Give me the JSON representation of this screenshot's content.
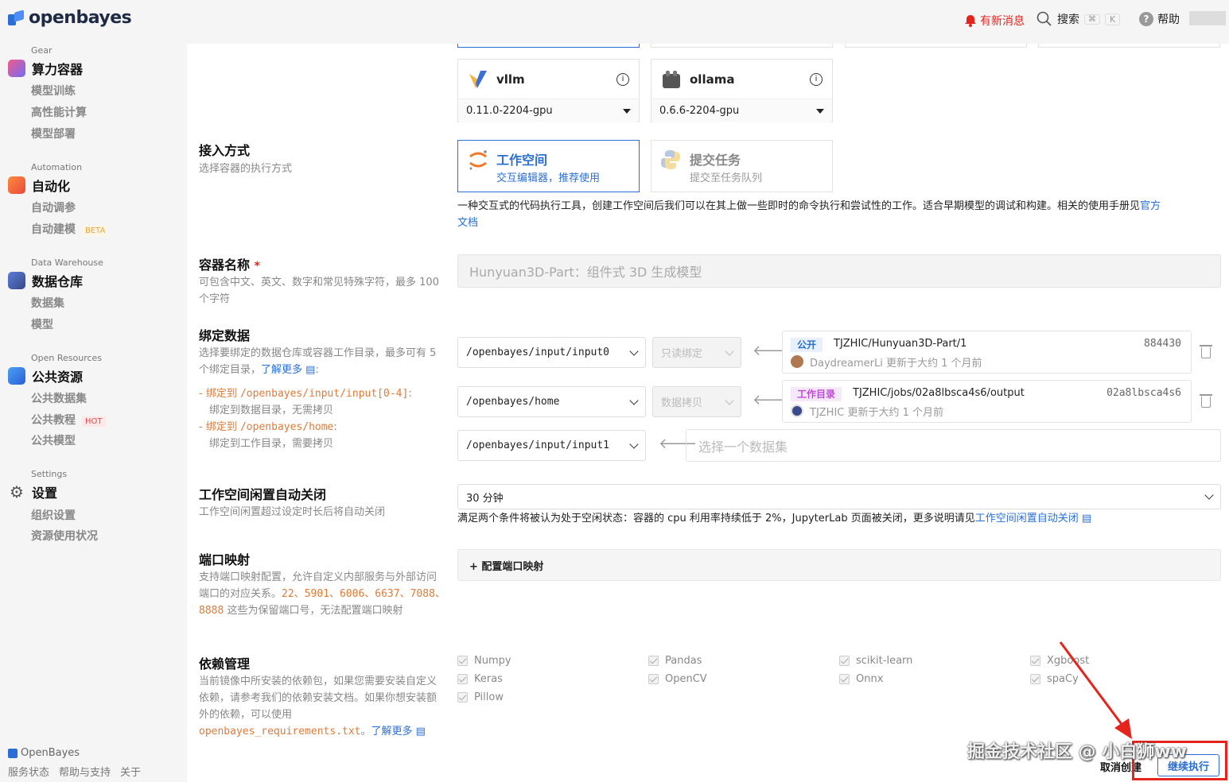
{
  "topbar": {
    "brand": "openbayes",
    "notifications": "有新消息",
    "search": "搜索",
    "search_key1": "⌘",
    "search_key2": "K",
    "help": "帮助"
  },
  "sidebar": {
    "sections": [
      {
        "category": "Gear",
        "title": "算力容器",
        "items": [
          "模型训练",
          "高性能计算",
          "模型部署"
        ]
      },
      {
        "category": "Automation",
        "title": "自动化",
        "items": [
          "自动调参",
          "自动建模"
        ],
        "badge": "BETA"
      },
      {
        "category": "Data Warehouse",
        "title": "数据仓库",
        "items": [
          "数据集",
          "模型"
        ]
      },
      {
        "category": "Open Resources",
        "title": "公共资源",
        "items": [
          "公共数据集",
          "公共教程",
          "公共模型"
        ],
        "badge": "HOT"
      },
      {
        "category": "Settings",
        "title": "设置",
        "items": [
          "组织设置",
          "资源使用状况"
        ]
      }
    ],
    "footer": {
      "brand": "OpenBayes",
      "links": [
        "服务状态",
        "帮助与支持",
        "关于"
      ]
    }
  },
  "images": [
    {
      "name": "vllm",
      "version": "0.11.0-2204-gpu"
    },
    {
      "name": "ollama",
      "version": "0.6.6-2204-gpu"
    }
  ],
  "access": {
    "title": "接入方式",
    "desc": "选择容器的执行方式",
    "workspace": {
      "title": "工作空间",
      "sub": "交互编辑器，推荐使用"
    },
    "task": {
      "title": "提交任务",
      "sub": "提交至任务队列"
    },
    "note": "一种交互式的代码执行工具，创建工作空间后我们可以在其上做一些即时的命令执行和尝试性的工作。适合早期模型的调试和构建。相关的使用手册见",
    "note_link1": "官方",
    "note_link2": "文档"
  },
  "container_name": {
    "title": "容器名称",
    "required": "*",
    "desc": "可包含中文、英文、数字和常见特殊字符，最多 100 个字符",
    "value": "Hunyuan3D-Part：组件式 3D 生成模型"
  },
  "bind": {
    "title": "绑定数据",
    "desc": "选择要绑定的数据仓库或容器工作目录，最多可有 5 个绑定目录，",
    "learn_more": "了解更多",
    "hint1_label": "绑定到",
    "hint1_path": "/openbayes/input/input[0-4]",
    "hint1_desc": "绑定到数据目录，无需拷贝",
    "hint2_label": "绑定到",
    "hint2_path": "/openbayes/home",
    "hint2_desc": "绑定到工作目录，需要拷贝",
    "rows": [
      {
        "path": "/openbayes/input/input0",
        "mode": "只读绑定",
        "tag": "公开",
        "source": "TJZHIC/Hunyuan3D-Part/1",
        "id": "884430",
        "meta": "DaydreamerLi 更新于大约 1 个月前"
      },
      {
        "path": "/openbayes/home",
        "mode": "数据拷贝",
        "tag": "工作目录",
        "source": "TJZHIC/jobs/02a8lbsca4s6/output",
        "id": "02a8lbsca4s6",
        "meta": "TJZHIC 更新于大约 1 个月前"
      },
      {
        "path": "/openbayes/input/input1",
        "placeholder": "选择一个数据集"
      }
    ]
  },
  "idle": {
    "title": "工作空间闲置自动关闭",
    "desc": "工作空间闲置超过设定时长后将自动关闭",
    "value": "30 分钟",
    "note": "满足两个条件将被认为处于空闲状态：容器的 cpu 利用率持续低于 2%，JupyterLab 页面被关闭，更多说明请见",
    "note_link": "工作空间闲置自动关闭"
  },
  "ports": {
    "title": "端口映射",
    "desc1": "支持端口映射配置，允许自定义内部服务与外部访问端口的对应关系。",
    "reserved": "22、5901、6006、6637、7088、8888",
    "desc2": "这些为保留端口号，无法配置端口映射",
    "button": "+ 配置端口映射"
  },
  "deps": {
    "title": "依赖管理",
    "desc": "当前镜像中所安装的依赖包，如果您需要安装自定义依赖，请参考我们的依赖安装文档。如果你想安装额外的依赖，可以使用",
    "file": "openbayes_requirements.txt",
    "learn_more": "了解更多",
    "packages": [
      "Numpy",
      "Pandas",
      "scikit-learn",
      "Xgboost",
      "Keras",
      "OpenCV",
      "Onnx",
      "spaCy",
      "Pillow"
    ]
  },
  "actions": {
    "cancel": "取消创建",
    "continue": "继续执行"
  },
  "watermark": "掘金技术社区 @ 小白狮ww",
  "colors": {
    "accent": "#2b6fd6",
    "orange": "#e07b39",
    "danger": "#e5251d"
  }
}
